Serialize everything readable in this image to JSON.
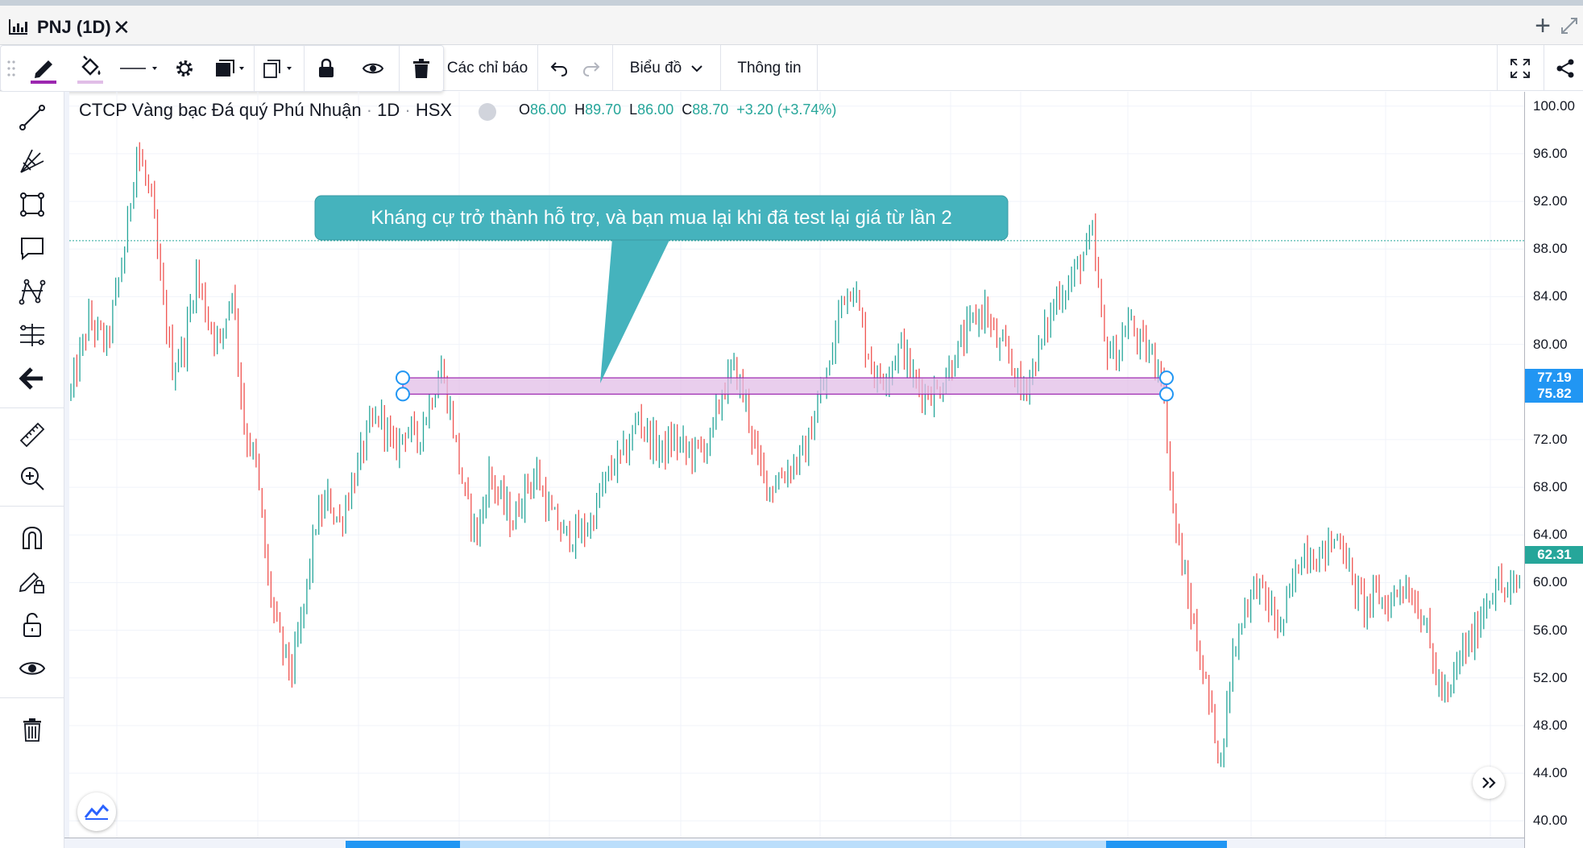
{
  "window": {
    "title": "PNJ (1D)"
  },
  "icons": {
    "app": "chart-bars-icon",
    "close": "close-icon",
    "add": "plus-icon",
    "expand": "expand-icon",
    "pencil": "pencil-icon",
    "fill": "paint-bucket-icon",
    "line_style": "line-style-icon",
    "settings": "gear-icon",
    "template": "template-icon",
    "clone": "clone-icon",
    "lock": "lock-icon",
    "visibility": "eye-icon",
    "trash": "trash-icon",
    "undo": "undo-icon",
    "redo": "redo-icon",
    "fullscreen": "fullscreen-icon",
    "share": "share-icon"
  },
  "toolbar": {
    "indicators_label": "Các chỉ báo",
    "chart_label": "Biểu đồ",
    "info_label": "Thông tin"
  },
  "legend": {
    "name": "CTCP Vàng bạc Đá quý Phú Nhuận",
    "interval": "1D",
    "exchange": "HSX",
    "o_label": "O",
    "o_value": "86.00",
    "h_label": "H",
    "h_value": "89.70",
    "l_label": "L",
    "l_value": "86.00",
    "c_label": "C",
    "c_value": "88.70",
    "change": "+3.20 (+3.74%)"
  },
  "callout": {
    "text": "Kháng cự trở thành hỗ trợ, và bạn mua lại khi đã test lại giá từ lần 2"
  },
  "price_scale": {
    "ticks": [
      "100.00",
      "96.00",
      "92.00",
      "88.00",
      "84.00",
      "80.00",
      "72.00",
      "68.00",
      "64.00",
      "60.00",
      "56.00",
      "52.00",
      "48.00",
      "44.00",
      "40.00"
    ],
    "labels": [
      {
        "text": "77.19",
        "value": 77.19,
        "color": "#2196f3"
      },
      {
        "text": "75.82",
        "value": 75.82,
        "color": "#2196f3"
      },
      {
        "text": "62.31",
        "value": 62.31,
        "color": "#26a69a"
      }
    ]
  },
  "chart_data": {
    "type": "candlestick",
    "up_color": "#26a69a",
    "down_color": "#ef5350",
    "ylim": [
      38.6,
      101.2
    ],
    "current_price_line": 88.7,
    "rectangle": {
      "top": 77.19,
      "bottom": 75.82,
      "color": "#e1bee7"
    },
    "price_path": [
      [
        0,
        76
      ],
      [
        6,
        82
      ],
      [
        12,
        80
      ],
      [
        18,
        88
      ],
      [
        22,
        96.5
      ],
      [
        27,
        92
      ],
      [
        30,
        85
      ],
      [
        34,
        78
      ],
      [
        38,
        80
      ],
      [
        42,
        86
      ],
      [
        46,
        82
      ],
      [
        50,
        80
      ],
      [
        54,
        85
      ],
      [
        58,
        73
      ],
      [
        62,
        70
      ],
      [
        66,
        60
      ],
      [
        70,
        55
      ],
      [
        74,
        52.5
      ],
      [
        78,
        58
      ],
      [
        82,
        65
      ],
      [
        86,
        67
      ],
      [
        90,
        65
      ],
      [
        95,
        69
      ],
      [
        100,
        73
      ],
      [
        104,
        74
      ],
      [
        108,
        71
      ],
      [
        112,
        73
      ],
      [
        116,
        72
      ],
      [
        120,
        75
      ],
      [
        124,
        78
      ],
      [
        128,
        73
      ],
      [
        132,
        67
      ],
      [
        136,
        64
      ],
      [
        140,
        69
      ],
      [
        144,
        67
      ],
      [
        148,
        65
      ],
      [
        152,
        68
      ],
      [
        156,
        69
      ],
      [
        160,
        66
      ],
      [
        165,
        64
      ],
      [
        170,
        64
      ],
      [
        174,
        65
      ],
      [
        178,
        68
      ],
      [
        182,
        70
      ],
      [
        186,
        71
      ],
      [
        190,
        74
      ],
      [
        194,
        72
      ],
      [
        198,
        71
      ],
      [
        202,
        72
      ],
      [
        206,
        71
      ],
      [
        210,
        71
      ],
      [
        214,
        72
      ],
      [
        218,
        76
      ],
      [
        222,
        78
      ],
      [
        226,
        75
      ],
      [
        230,
        70
      ],
      [
        234,
        68
      ],
      [
        238,
        69
      ],
      [
        242,
        70
      ],
      [
        246,
        71
      ],
      [
        250,
        75
      ],
      [
        254,
        78
      ],
      [
        258,
        84
      ],
      [
        262,
        85
      ],
      [
        266,
        80
      ],
      [
        270,
        77
      ],
      [
        274,
        78
      ],
      [
        278,
        80
      ],
      [
        282,
        77
      ],
      [
        286,
        76
      ],
      [
        290,
        76
      ],
      [
        294,
        78
      ],
      [
        298,
        80
      ],
      [
        302,
        82
      ],
      [
        306,
        83
      ],
      [
        310,
        80
      ],
      [
        314,
        79
      ],
      [
        318,
        76
      ],
      [
        322,
        78
      ],
      [
        326,
        81
      ],
      [
        330,
        84
      ],
      [
        334,
        85
      ],
      [
        338,
        87
      ],
      [
        342,
        89
      ],
      [
        346,
        80
      ],
      [
        350,
        79
      ],
      [
        354,
        82
      ],
      [
        358,
        80
      ],
      [
        362,
        79
      ],
      [
        365,
        78
      ],
      [
        369,
        66
      ],
      [
        373,
        60
      ],
      [
        377,
        55
      ],
      [
        381,
        50
      ],
      [
        385,
        45
      ],
      [
        389,
        54
      ],
      [
        393,
        58
      ],
      [
        397,
        60
      ],
      [
        401,
        58
      ],
      [
        405,
        56
      ],
      [
        409,
        60
      ],
      [
        413,
        63
      ],
      [
        417,
        62
      ],
      [
        421,
        63
      ],
      [
        425,
        64
      ],
      [
        429,
        60
      ],
      [
        433,
        58
      ],
      [
        437,
        59
      ],
      [
        441,
        58
      ],
      [
        445,
        60
      ],
      [
        449,
        59
      ],
      [
        453,
        57
      ],
      [
        457,
        52
      ],
      [
        461,
        50
      ],
      [
        465,
        54
      ],
      [
        469,
        55
      ],
      [
        473,
        58
      ],
      [
        477,
        60
      ],
      [
        481,
        59
      ],
      [
        485,
        60
      ]
    ]
  }
}
